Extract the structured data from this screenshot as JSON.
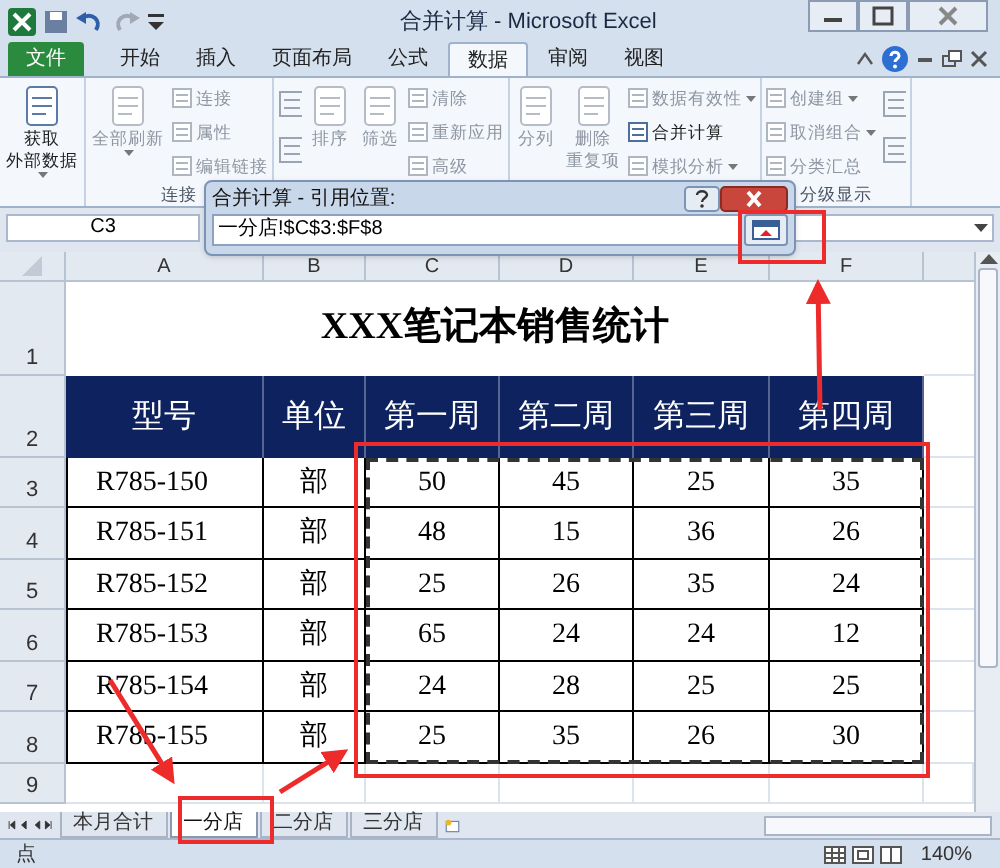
{
  "window": {
    "title": "合并计算 - Microsoft Excel"
  },
  "ribbon_tabs": [
    {
      "label": "文件",
      "kind": "file",
      "selected": false
    },
    {
      "label": "开始",
      "kind": "tab",
      "selected": false
    },
    {
      "label": "插入",
      "kind": "tab",
      "selected": false
    },
    {
      "label": "页面布局",
      "kind": "tab",
      "selected": false
    },
    {
      "label": "公式",
      "kind": "tab",
      "selected": false
    },
    {
      "label": "数据",
      "kind": "tab",
      "selected": true
    },
    {
      "label": "审阅",
      "kind": "tab",
      "selected": false
    },
    {
      "label": "视图",
      "kind": "tab",
      "selected": false
    }
  ],
  "ribbon_groups": [
    {
      "columns": [
        [
          {
            "kind": "large",
            "label_lines": [
              "获取",
              "外部数据"
            ],
            "dropdown": true,
            "disabled": false
          }
        ]
      ]
    },
    {
      "label": "连接",
      "columns": [
        [
          {
            "kind": "large",
            "label_lines": [
              "全部刷新"
            ],
            "dropdown": true,
            "disabled": true
          }
        ],
        [
          {
            "kind": "small",
            "label": "连接",
            "dropdown": false,
            "disabled": true
          },
          {
            "kind": "small",
            "label": "属性",
            "dropdown": false,
            "disabled": true
          },
          {
            "kind": "small",
            "label": "编辑链接",
            "dropdown": false,
            "disabled": true
          }
        ]
      ]
    },
    {
      "columns": [
        [
          {
            "kind": "icon",
            "disabled": true
          },
          {
            "kind": "icon",
            "disabled": true
          }
        ],
        [
          {
            "kind": "large",
            "label_lines": [
              "排序"
            ],
            "dropdown": false,
            "disabled": true
          }
        ],
        [
          {
            "kind": "large",
            "label_lines": [
              "筛选"
            ],
            "dropdown": false,
            "disabled": true
          }
        ],
        [
          {
            "kind": "small",
            "label": "清除",
            "dropdown": false,
            "disabled": true
          },
          {
            "kind": "small",
            "label": "重新应用",
            "dropdown": false,
            "disabled": true
          },
          {
            "kind": "small",
            "label": "高级",
            "dropdown": false,
            "disabled": true
          }
        ]
      ]
    },
    {
      "columns": [
        [
          {
            "kind": "large",
            "label_lines": [
              "分列"
            ],
            "dropdown": false,
            "disabled": true
          }
        ],
        [
          {
            "kind": "large",
            "label_lines": [
              "删除",
              "重复项"
            ],
            "dropdown": false,
            "disabled": true
          }
        ],
        [
          {
            "kind": "small",
            "label": "数据有效性",
            "dropdown": true,
            "disabled": true
          },
          {
            "kind": "small",
            "label": "合并计算",
            "dropdown": false,
            "disabled": false
          },
          {
            "kind": "small",
            "label": "模拟分析",
            "dropdown": true,
            "disabled": true
          }
        ]
      ]
    },
    {
      "label": "分级显示",
      "columns": [
        [
          {
            "kind": "small",
            "label": "创建组",
            "dropdown": true,
            "disabled": true
          },
          {
            "kind": "small",
            "label": "取消组合",
            "dropdown": true,
            "disabled": true
          },
          {
            "kind": "small",
            "label": "分类汇总",
            "dropdown": false,
            "disabled": true
          }
        ],
        [
          {
            "kind": "icon",
            "disabled": true
          },
          {
            "kind": "icon",
            "disabled": true
          }
        ]
      ]
    }
  ],
  "name_box": "C3",
  "dialog": {
    "title": "合并计算 - 引用位置:",
    "value": "一分店!$C$3:$F$8"
  },
  "sheet": {
    "columns": [
      "A",
      "B",
      "C",
      "D",
      "E",
      "F"
    ],
    "row_numbers": [
      "1",
      "2",
      "3",
      "4",
      "5",
      "6",
      "7",
      "8",
      "9"
    ],
    "title": "XXX笔记本销售统计",
    "header": [
      "型号",
      "单位",
      "第一周",
      "第二周",
      "第三周",
      "第四周"
    ],
    "rows": [
      [
        "R785-150",
        "部",
        "50",
        "45",
        "25",
        "35"
      ],
      [
        "R785-151",
        "部",
        "48",
        "15",
        "36",
        "26"
      ],
      [
        "R785-152",
        "部",
        "25",
        "26",
        "35",
        "24"
      ],
      [
        "R785-153",
        "部",
        "65",
        "24",
        "24",
        "12"
      ],
      [
        "R785-154",
        "部",
        "24",
        "28",
        "25",
        "25"
      ],
      [
        "R785-155",
        "部",
        "25",
        "35",
        "26",
        "30"
      ]
    ]
  },
  "sheet_tabs": [
    {
      "label": "本月合计",
      "selected": false
    },
    {
      "label": "一分店",
      "selected": true
    },
    {
      "label": "二分店",
      "selected": false
    },
    {
      "label": "三分店",
      "selected": false
    }
  ],
  "status_bar": {
    "mode": "点",
    "zoom": "140%"
  }
}
